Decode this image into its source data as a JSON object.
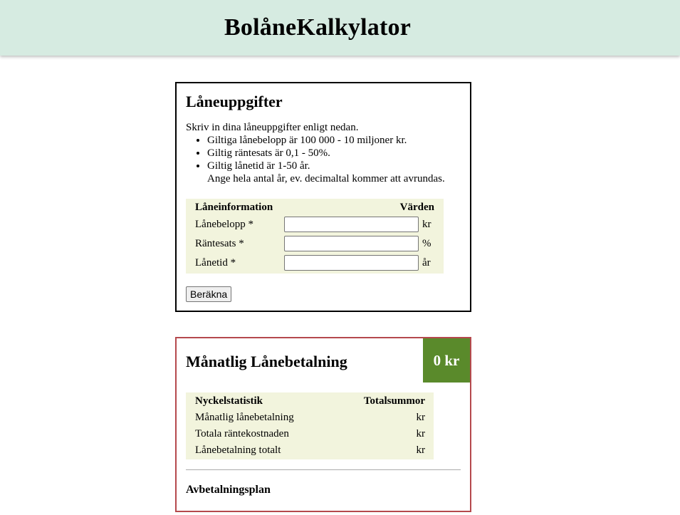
{
  "header": {
    "title": "BolåneKalkylator"
  },
  "loan_form": {
    "title": "Låneuppgifter",
    "intro": "Skriv in dina låneuppgifter enligt nedan.",
    "rules": [
      "Giltiga lånebelopp är 100 000 - 10 miljoner kr.",
      "Giltig räntesats är 0,1 - 50%.",
      "Giltig lånetid är 1-50 år."
    ],
    "rule_note": "Ange hela antal år, ev. decimaltal kommer att avrundas.",
    "table_header_left": "Låneinformation",
    "table_header_right": "Värden",
    "fields": [
      {
        "label": "Lånebelopp *",
        "value": "",
        "unit": "kr"
      },
      {
        "label": "Räntesats *",
        "value": "",
        "unit": "%"
      },
      {
        "label": "Lånetid *",
        "value": "",
        "unit": "år"
      }
    ],
    "calculate_label": "Beräkna"
  },
  "result": {
    "title": "Månatlig Lånebetalning",
    "monthly_payment_badge": "0 kr",
    "badge_color": "#5a8a2b",
    "border_color": "#b5494d",
    "table_header_left": "Nyckelstatistik",
    "table_header_right": "Totalsummor",
    "rows": [
      {
        "label": "Månatlig lånebetalning",
        "value": "kr"
      },
      {
        "label": "Totala räntekostnaden",
        "value": "kr"
      },
      {
        "label": "Lånebetalning totalt",
        "value": "kr"
      }
    ],
    "plan_title": "Avbetalningsplan"
  },
  "colors": {
    "header_bg": "#d6ebe1",
    "table_bg": "#f2f4dd"
  }
}
